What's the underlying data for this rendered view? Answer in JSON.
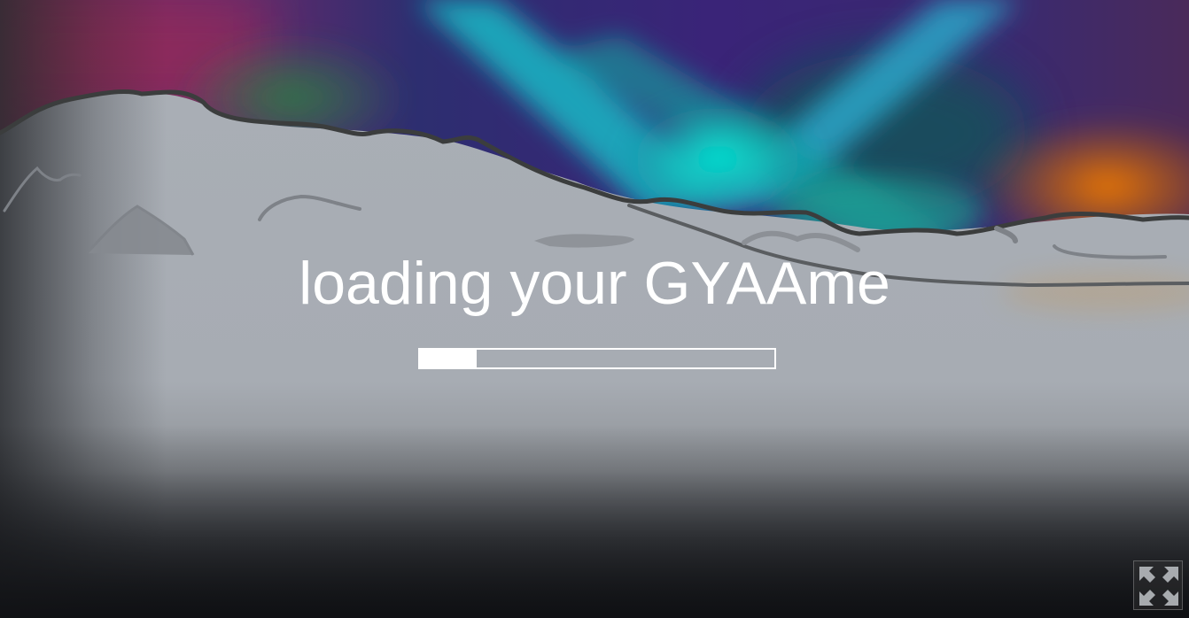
{
  "loader": {
    "title": "loading your GYAAme",
    "progress": 0.16
  },
  "controls": {
    "fullscreen_icon": "expand-arrows-icon"
  },
  "colors": {
    "text": "#ffffff",
    "progress_bar": "#ffffff",
    "aurora_teal": "#00e5d0",
    "aurora_purple": "#5a2a9a",
    "aurora_magenta": "#9a2a6a",
    "sunset_orange": "#e07a10",
    "snow": "#a7adb4",
    "ridge_line": "#3c3e3e"
  }
}
